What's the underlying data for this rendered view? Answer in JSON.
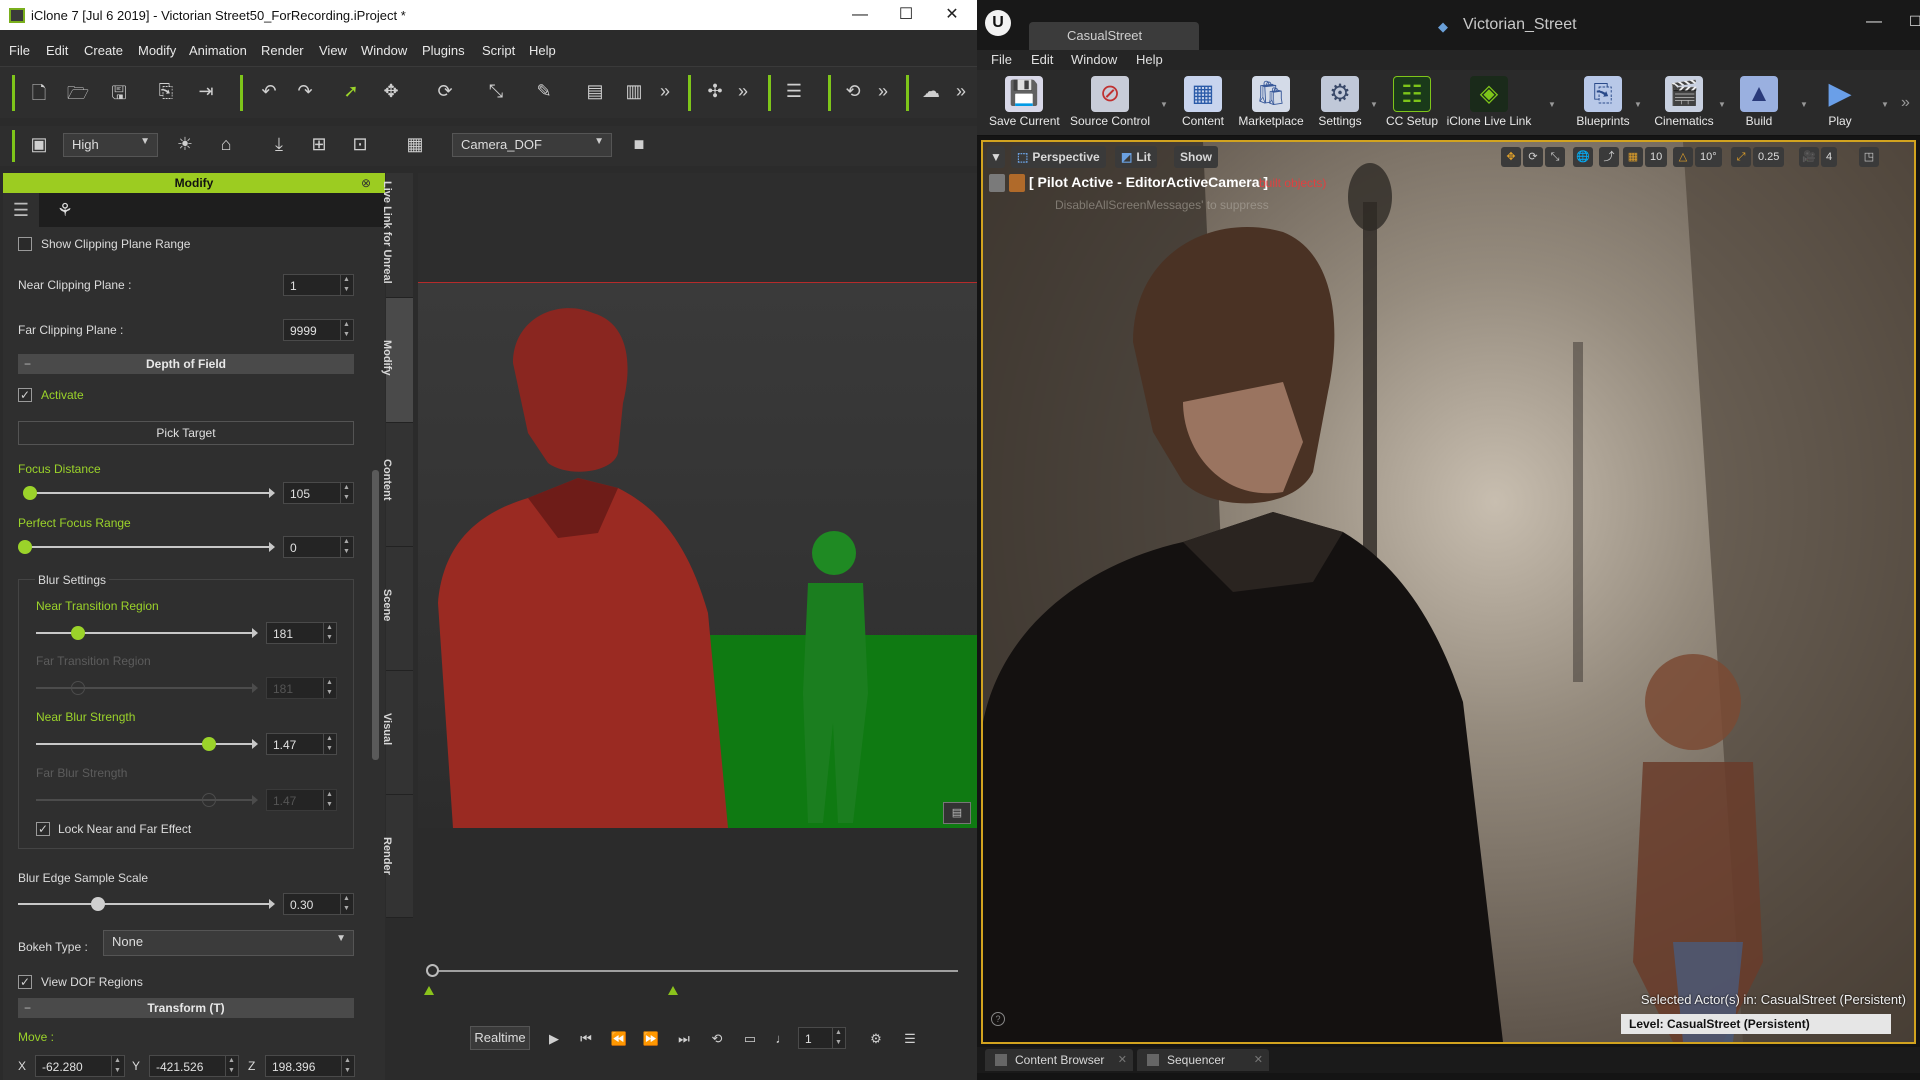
{
  "iclone": {
    "title": "iClone 7 [Jul  6 2019] - Victorian Street50_ForRecording.iProject *",
    "window_buttons": [
      "—",
      "☐",
      "✕"
    ],
    "menu": [
      "File",
      "Edit",
      "Create",
      "Modify",
      "Animation",
      "Render",
      "View",
      "Window",
      "Plugins",
      "Script",
      "Help"
    ],
    "quality_select": "High",
    "camera_select": "Camera_DOF",
    "panel": {
      "header": "Modify",
      "show_clipping_plane_range": "Show Clipping Plane Range",
      "near_clipping_label": "Near Clipping Plane :",
      "near_clipping_value": "1",
      "far_clipping_label": "Far Clipping Plane :",
      "far_clipping_value": "9999",
      "dof_section": "Depth of Field",
      "activate_label": "Activate",
      "pick_target": "Pick Target",
      "focus_distance_label": "Focus Distance",
      "focus_distance_value": "105",
      "perfect_focus_label": "Perfect Focus Range",
      "perfect_focus_value": "0",
      "blur_settings_label": "Blur Settings",
      "near_transition_label": "Near Transition Region",
      "near_transition_value": "181",
      "far_transition_label": "Far Transition Region",
      "far_transition_value": "181",
      "near_blur_label": "Near Blur Strength",
      "near_blur_value": "1.47",
      "far_blur_label": "Far Blur Strength",
      "far_blur_value": "1.47",
      "lock_near_far_label": "Lock Near and Far Effect",
      "blur_edge_label": "Blur Edge Sample Scale",
      "blur_edge_value": "0.30",
      "bokeh_label": "Bokeh Type :",
      "bokeh_value": "None",
      "view_dof_label": "View DOF Regions",
      "transform_section": "Transform  (T)",
      "move_label": "Move :",
      "move_x_label": "X",
      "move_x": "-62.280",
      "move_y_label": "Y",
      "move_y": "-421.526",
      "move_z_label": "Z",
      "move_z": "198.396"
    },
    "side_tabs": [
      "Live Link for Unreal",
      "Modify",
      "Content",
      "Scene",
      "Visual",
      "Render"
    ],
    "playbar": {
      "realtime": "Realtime",
      "frame": "1"
    }
  },
  "unreal": {
    "tab": "CasualStreet",
    "project": "Victorian_Street",
    "window_buttons": [
      "—",
      "☐"
    ],
    "menu": [
      "File",
      "Edit",
      "Window",
      "Help"
    ],
    "toolbar": [
      {
        "label": "Save Current",
        "icon": "save-icon"
      },
      {
        "label": "Source Control",
        "icon": "source-control-icon"
      },
      {
        "label": "Content",
        "icon": "content-icon"
      },
      {
        "label": "Marketplace",
        "icon": "marketplace-icon"
      },
      {
        "label": "Settings",
        "icon": "settings-icon"
      },
      {
        "label": "CC Setup",
        "icon": "cc-setup-icon"
      },
      {
        "label": "iClone Live Link",
        "icon": "live-link-icon"
      },
      {
        "label": "Blueprints",
        "icon": "blueprints-icon"
      },
      {
        "label": "Cinematics",
        "icon": "cinematics-icon"
      },
      {
        "label": "Build",
        "icon": "build-icon"
      },
      {
        "label": "Play",
        "icon": "play-icon"
      }
    ],
    "viewport": {
      "perspective": "Perspective",
      "lit": "Lit",
      "show": "Show",
      "grid_value": "10",
      "angle_value": "10°",
      "scale_value": "0.25",
      "camera_speed": "4",
      "pilot": "[ Pilot Active - EditorActiveCamera ]",
      "pilot_warning": "built objects)",
      "ghost_text": "DisableAllScreenMessages' to suppress",
      "selected_actor": "Selected Actor(s) in:  CasualStreet (Persistent)",
      "level": "Level:  CasualStreet (Persistent)"
    },
    "bottom_tabs": [
      "Content Browser",
      "Sequencer"
    ]
  }
}
